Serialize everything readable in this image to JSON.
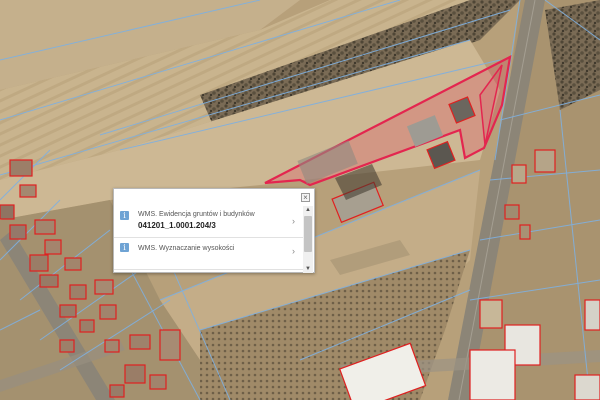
{
  "map": {
    "highlight_color": "#e3264f",
    "parcel_outline_color": "#7fb0e0",
    "building_outline_color": "#e02020"
  },
  "popup": {
    "close_label": "×",
    "items": [
      {
        "icon": "info-icon",
        "icon_glyph": "i",
        "title": "WMS. Ewidencja gruntów i budynków",
        "value": "041201_1.0001.204/3",
        "arrow": "›"
      },
      {
        "icon": "info-icon",
        "icon_glyph": "i",
        "title": "WMS. Wyznaczanie wysokości",
        "arrow": "›"
      }
    ],
    "scroll_up": "▲",
    "scroll_down": "▼"
  }
}
